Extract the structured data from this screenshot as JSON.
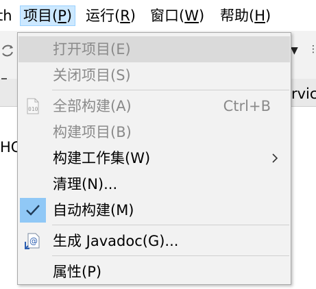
{
  "menubar": {
    "items": [
      {
        "label": "th",
        "mnemonic": ""
      },
      {
        "label": "项目(",
        "mnemonic": "P",
        "suffix": ")"
      },
      {
        "label": "运行(",
        "mnemonic": "R",
        "suffix": ")"
      },
      {
        "label": "窗口(",
        "mnemonic": "W",
        "suffix": ")"
      },
      {
        "label": "帮助(",
        "mnemonic": "H",
        "suffix": ")"
      }
    ]
  },
  "background": {
    "right_text": "rvic",
    "left_text": "HC"
  },
  "menu": {
    "items": [
      {
        "label": "打开项目(E)",
        "enabled": false
      },
      {
        "label": "关闭项目(S)",
        "enabled": false
      },
      {
        "label": "全部构建(A)",
        "shortcut": "Ctrl+B",
        "enabled": false,
        "icon": "build-all-icon"
      },
      {
        "label": "构建项目(B)",
        "enabled": false
      },
      {
        "label": "构建工作集(W)",
        "enabled": true,
        "submenu": true
      },
      {
        "label": "清理(N)...",
        "enabled": true
      },
      {
        "label": "自动构建(M)",
        "enabled": true,
        "checked": true
      },
      {
        "label": "生成 Javadoc(G)...",
        "enabled": true,
        "icon": "javadoc-icon"
      },
      {
        "label": "属性(P)",
        "enabled": true
      }
    ]
  },
  "colors": {
    "menu_bg": "#f2f2f2",
    "hover_bg": "#dadada",
    "checked_bg": "#90c8f6",
    "active_menubar_bg": "#cce8ff",
    "disabled_text": "#8a8a8a"
  }
}
